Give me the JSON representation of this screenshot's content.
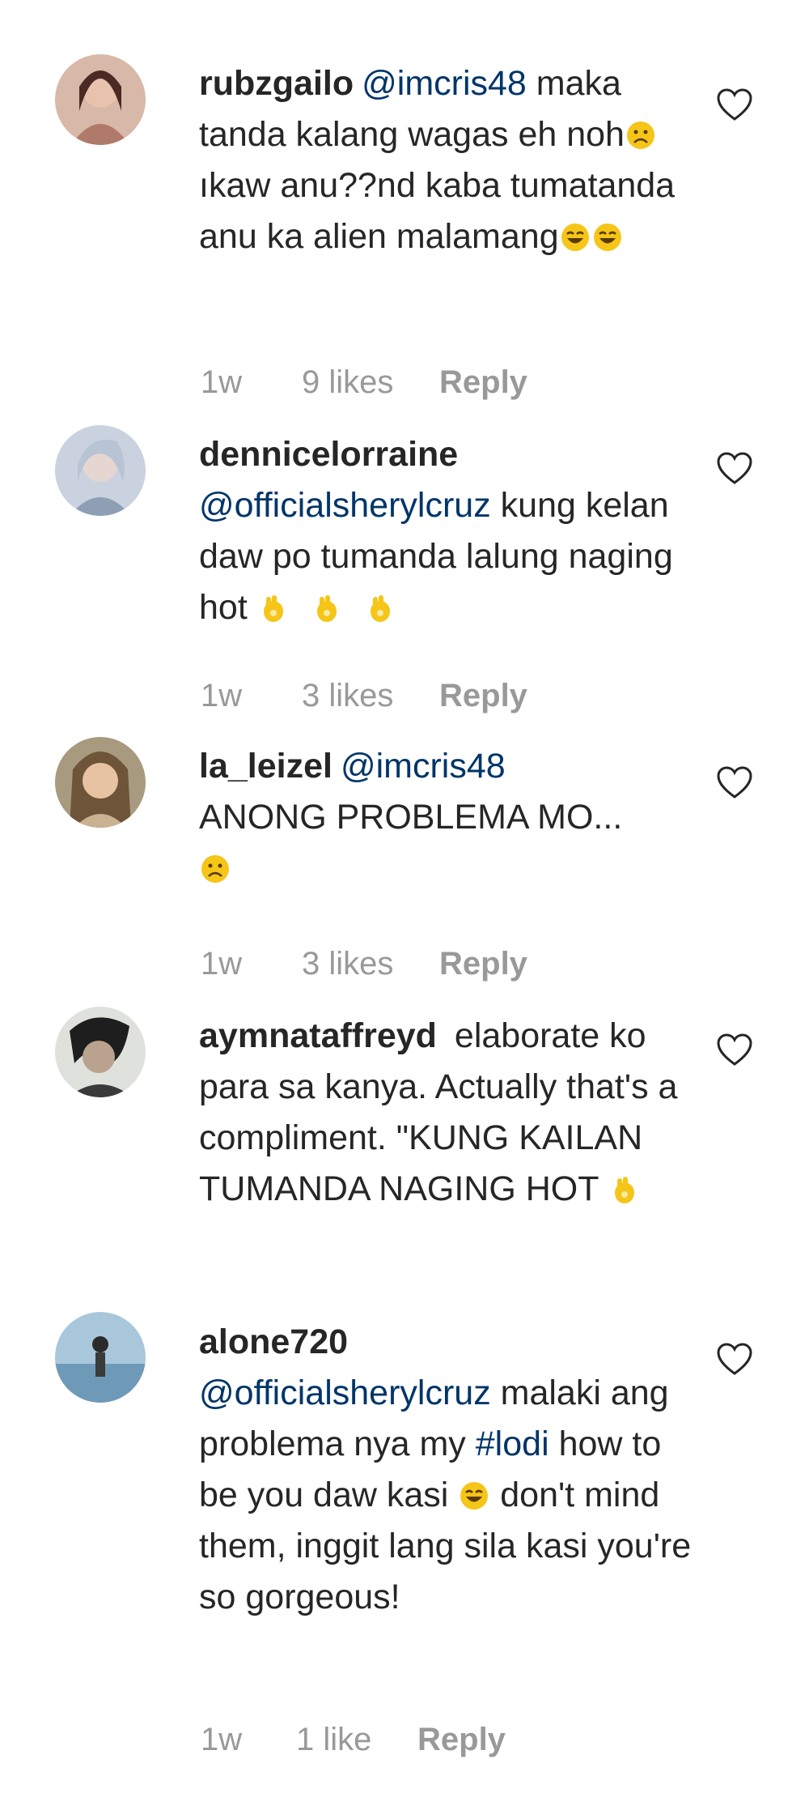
{
  "comments": [
    {
      "username": "rubzgailo",
      "mention": "@imcris48",
      "text_1": " maka tanda kalang wagas eh noh",
      "text_2": "ıkaw anu??nd kaba tumatanda anu ka alien malamang",
      "emojis": [
        "sad-face",
        "grin-face",
        "grin-face"
      ],
      "time": "1w",
      "likes": "9 likes",
      "reply": "Reply"
    },
    {
      "username": "dennicelorraine",
      "mention": "@officialsherylcruz",
      "text_1": " kung kelan daw po tumanda lalung naging hot ",
      "emojis": [
        "ok-hand",
        "ok-hand",
        "ok-hand"
      ],
      "time": "1w",
      "likes": "3 likes",
      "reply": "Reply"
    },
    {
      "username": "la_leizel",
      "mention": "@imcris48",
      "text_1": " ANONG PROBLEMA MO...",
      "emojis": [
        "sad-face"
      ],
      "time": "1w",
      "likes": "3 likes",
      "reply": "Reply"
    },
    {
      "username": "aymnataffreyd",
      "text_1": " elaborate ko para sa kanya. Actually that's a compliment. \"KUNG KAILAN TUMANDA NAGING HOT ",
      "emojis": [
        "ok-hand"
      ],
      "time": "",
      "likes": "",
      "reply": ""
    },
    {
      "username": "alone720",
      "mention": "@officialsherylcruz",
      "text_1": " malaki ang problema nya my ",
      "hashtag": "#lodi",
      "text_2": " how to be you daw kasi ",
      "text_3": " don't mind them, inggit lang sila kasi you're so gorgeous!",
      "emojis": [
        "grin-face"
      ],
      "time": "1w",
      "likes": "1 like",
      "reply": "Reply"
    }
  ],
  "colors": {
    "text": "#262626",
    "link": "#003569",
    "meta": "#999999",
    "emoji_yellow": "#f5c518"
  }
}
